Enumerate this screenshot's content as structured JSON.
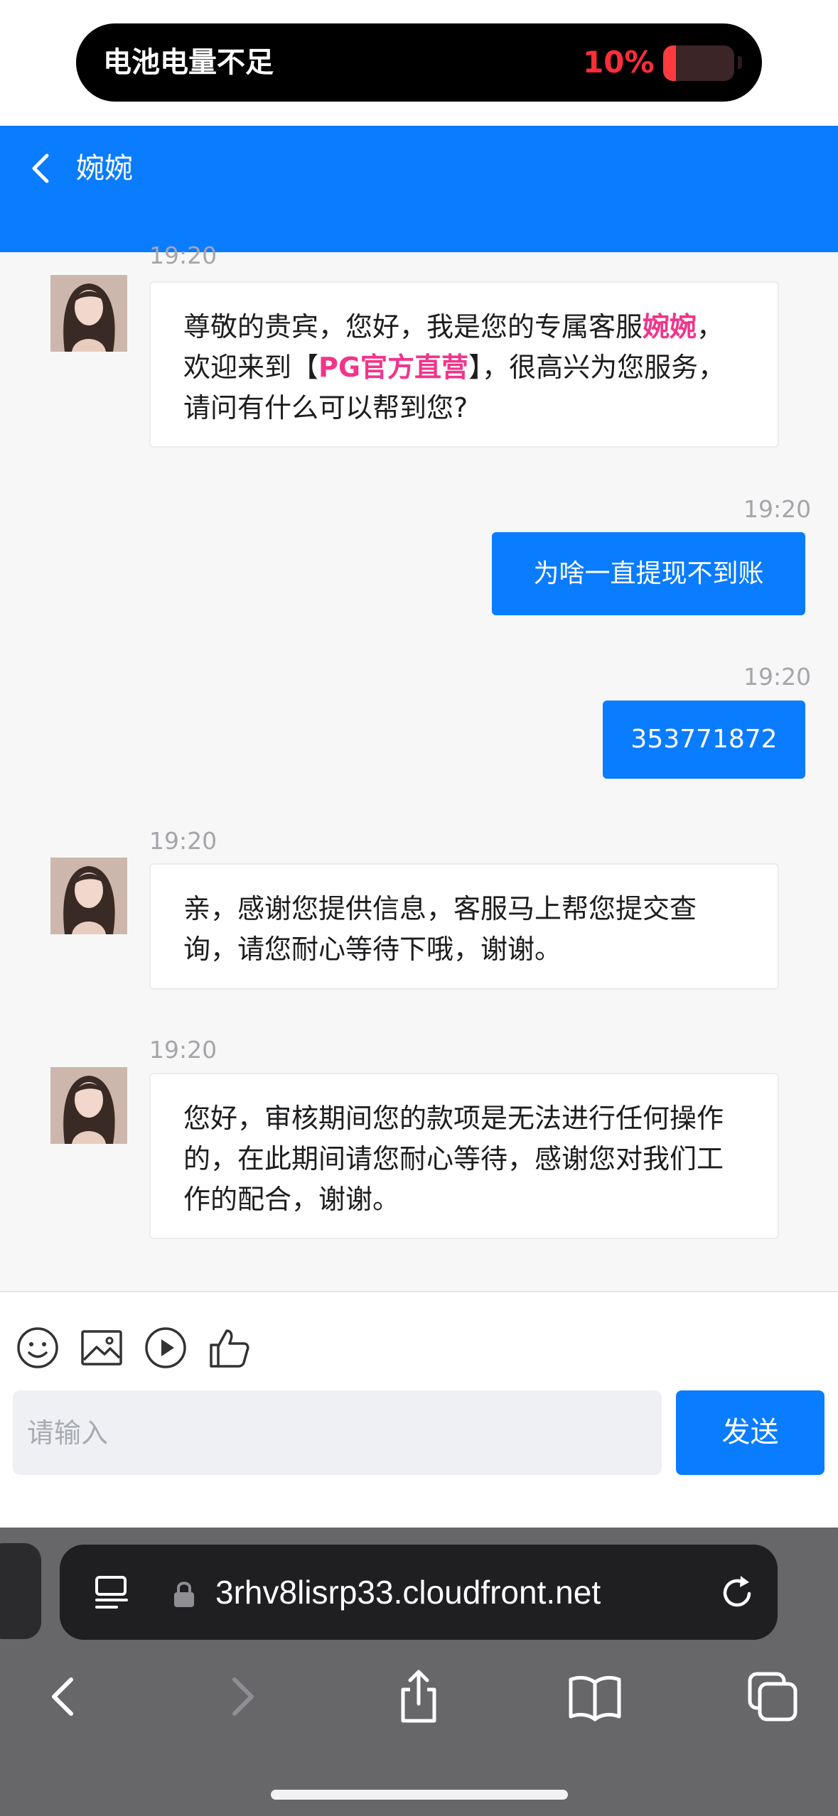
{
  "status": {
    "battery_warning": "电池电量不足",
    "battery_percent": "10%",
    "battery_level": 0.1,
    "colors": {
      "percent": "#ff2d3a"
    }
  },
  "header": {
    "back_icon": "chevron-left-icon",
    "title": "婉婉",
    "background": "#0a7cff"
  },
  "messages": [
    {
      "side": "agent",
      "time": "19:20",
      "segments": [
        "尊敬的贵宾，您好，我是您的专属客服",
        "婉婉",
        "，欢迎来到【",
        "PG官方直营",
        "】，很高兴为您服务，请问有什么可以帮到您?"
      ]
    },
    {
      "side": "user",
      "time": "19:20",
      "text": "为啥一直提现不到账"
    },
    {
      "side": "user",
      "time": "19:20",
      "text": "353771872"
    },
    {
      "side": "agent",
      "time": "19:20",
      "text": "亲，感谢您提供信息，客服马上帮您提交查询，请您耐心等待下哦，谢谢。"
    },
    {
      "side": "agent",
      "time": "19:20",
      "text": "您好，审核期间您的款项是无法进行任何操作的，在此期间请您耐心等待，感谢您对我们工作的配合，谢谢。"
    }
  ],
  "toolbar": {
    "icons": [
      "smiley-icon",
      "image-icon",
      "play-icon",
      "thumbs-up-icon"
    ]
  },
  "composer": {
    "placeholder": "请输入",
    "send_label": "发送"
  },
  "browser": {
    "url": "3rhv8lisrp33.cloudfront.net",
    "icons": [
      "reader-icon",
      "lock-icon",
      "reload-icon",
      "back-icon",
      "forward-icon",
      "share-icon",
      "bookmarks-icon",
      "tabs-icon"
    ]
  }
}
